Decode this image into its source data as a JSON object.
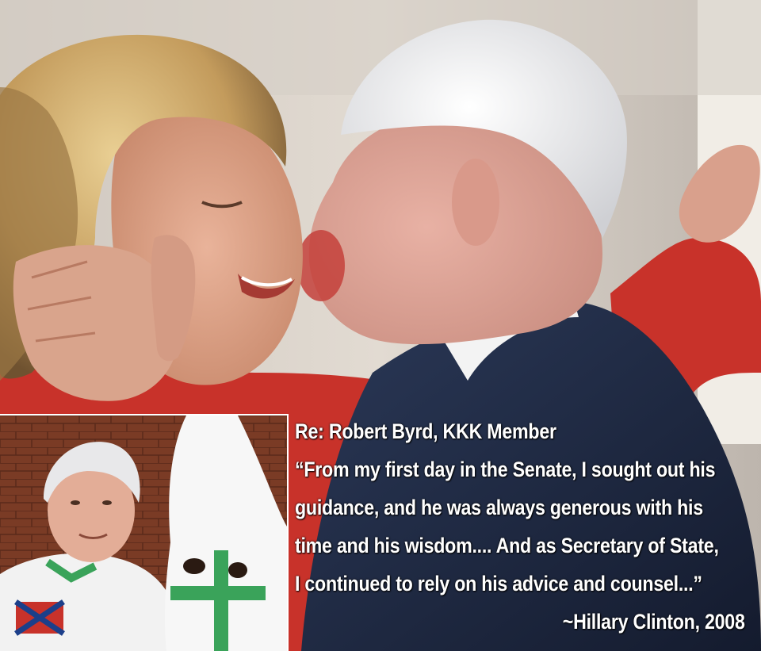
{
  "caption": {
    "heading": "Re: Robert Byrd, KKK Member",
    "lines": [
      "“From my first day in the Senate, I sought out his",
      "guidance, and he was always generous with his",
      "time and his wisdom.... And as Secretary of State,",
      "I continued to rely on his advice and counsel...”"
    ],
    "attribution": "~Hillary Clinton, 2008"
  },
  "colors": {
    "caption_text": "#ffffff",
    "dark_suit": "#1c2740",
    "red_jacket": "#c8322a",
    "background_wall": "#d9d2c9"
  },
  "icons": {
    "main_photo": "photo-woman-and-elderly-man-kiss",
    "inset_photo": "photo-man-in-white-robe-with-hooded-figure"
  }
}
